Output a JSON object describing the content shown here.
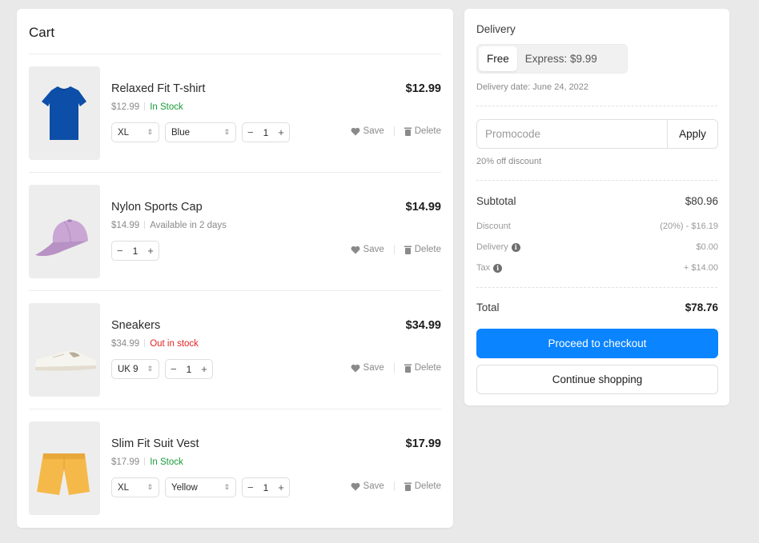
{
  "cart": {
    "title": "Cart",
    "items": [
      {
        "name": "Relaxed Fit T-shirt",
        "unit_price": "$12.99",
        "status": "In Stock",
        "status_color": "#1a9a3a",
        "price": "$12.99",
        "size": "XL",
        "color": "Blue",
        "quantity": "1",
        "image_icon": "tshirt-blue",
        "save_label": "Save",
        "delete_label": "Delete"
      },
      {
        "name": "Nylon Sports Cap",
        "unit_price": "$14.99",
        "status": "Available in 2 days",
        "status_color": "#8a8a8a",
        "price": "$14.99",
        "quantity": "1",
        "image_icon": "cap-lilac",
        "save_label": "Save",
        "delete_label": "Delete"
      },
      {
        "name": "Sneakers",
        "unit_price": "$34.99",
        "status": "Out in stock",
        "status_color": "#e02424",
        "price": "$34.99",
        "size": "UK 9",
        "quantity": "1",
        "image_icon": "sneaker-white",
        "save_label": "Save",
        "delete_label": "Delete"
      },
      {
        "name": "Slim Fit Suit Vest",
        "unit_price": "$17.99",
        "status": "In Stock",
        "status_color": "#1a9a3a",
        "price": "$17.99",
        "size": "XL",
        "color": "Yellow",
        "quantity": "1",
        "image_icon": "shorts-yellow",
        "save_label": "Save",
        "delete_label": "Delete"
      }
    ]
  },
  "summary": {
    "delivery_label": "Delivery",
    "delivery_options": [
      "Free",
      "Express: $9.99"
    ],
    "delivery_selected": "Free",
    "delivery_date": "Delivery date: June 24, 2022",
    "promo_placeholder": "Promocode",
    "promo_apply": "Apply",
    "promo_note": "20% off discount",
    "subtotal_label": "Subtotal",
    "subtotal_value": "$80.96",
    "discount_label": "Discount",
    "discount_value": "(20%) - $16.19",
    "delivery_row_label": "Delivery",
    "delivery_row_value": "$0.00",
    "tax_label": "Tax",
    "tax_value": "+ $14.00",
    "total_label": "Total",
    "total_value": "$78.76",
    "checkout_label": "Proceed to checkout",
    "continue_label": "Continue shopping"
  },
  "icons": {
    "select_arrow": "updown-chevron-icon",
    "minus": "−",
    "plus": "+",
    "save": "heart-icon",
    "delete": "trash-icon",
    "info": "info-icon"
  },
  "colors": {
    "accent": "#0a84ff",
    "in_stock": "#1a9a3a",
    "out_of_stock": "#e02424",
    "background": "#e9e9e9"
  }
}
